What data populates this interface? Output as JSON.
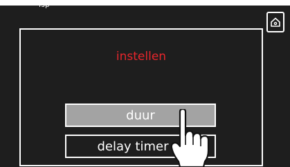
{
  "header": {
    "partial_label": "Isp",
    "home_icon": "home-icon"
  },
  "dialog": {
    "title": "instellen",
    "title_color": "#e8262c",
    "options": [
      {
        "label": "duur",
        "selected": true
      },
      {
        "label": "delay timer",
        "selected": false
      }
    ]
  },
  "colors": {
    "background": "#1e1e1e",
    "selected_button": "#a3a3a3",
    "outline": "#ffffff"
  },
  "overlay": {
    "icon": "pointing-hand-icon"
  }
}
